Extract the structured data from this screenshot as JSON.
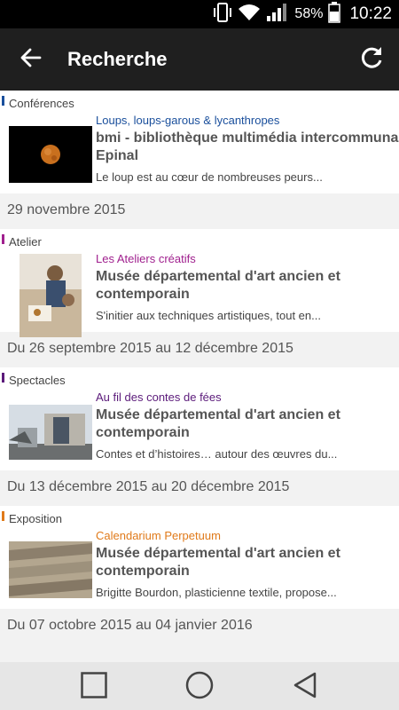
{
  "status_bar": {
    "battery_percent": "58%",
    "time": "10:22",
    "icons": [
      "vibrate-icon",
      "wifi-icon",
      "signal-icon",
      "battery-icon"
    ]
  },
  "app_bar": {
    "title": "Recherche",
    "back_icon": "arrow-left-icon",
    "refresh_icon": "refresh-icon"
  },
  "events": [
    {
      "category": "Conférences",
      "category_color": "#1a4f9c",
      "subtitle": "Loups, loups-garous & lycanthropes",
      "subtitle_color": "#1a4f9c",
      "venue_line1": "bmi - bibliothèque multimédia intercommunale",
      "venue_line2": "Epinal",
      "description": "Le loup est au cœur de nombreuses peurs...",
      "date": "29 novembre 2015"
    },
    {
      "category": "Atelier",
      "category_color": "#a0208e",
      "subtitle": "Les Ateliers créatifs",
      "subtitle_color": "#a0208e",
      "venue_line1": "Musée départemental d'art ancien et",
      "venue_line2": "contemporain",
      "description": "S'initier aux techniques artistiques, tout en...",
      "date": "Du 26 septembre 2015 au 12 décembre 2015"
    },
    {
      "category": "Spectacles",
      "category_color": "#5b1a7a",
      "subtitle": "Au fil des contes de fées",
      "subtitle_color": "#5b1a7a",
      "venue_line1": "Musée départemental d'art ancien et",
      "venue_line2": "contemporain",
      "description": "Contes et d’histoires… autour des œuvres du...",
      "date": "Du 13 décembre 2015 au 20 décembre 2015"
    },
    {
      "category": "Exposition",
      "category_color": "#e07a1a",
      "subtitle": "Calendarium Perpetuum",
      "subtitle_color": "#e07a1a",
      "venue_line1": "Musée départemental d'art ancien et",
      "venue_line2": "contemporain",
      "description": "Brigitte Bourdon, plasticienne textile, propose...",
      "date": "Du 07 octobre 2015 au 04 janvier 2016"
    }
  ],
  "nav_bar": {
    "icons": [
      "recents-square-icon",
      "home-circle-icon",
      "back-triangle-icon"
    ]
  }
}
